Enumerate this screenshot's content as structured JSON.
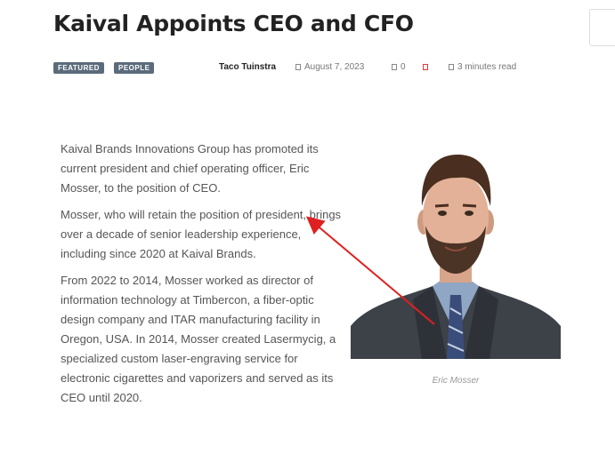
{
  "article": {
    "title": "Kaival Appoints CEO and CFO",
    "tags": [
      "FEATURED",
      "PEOPLE"
    ],
    "author": "Taco Tuinstra",
    "date": "August 7, 2023",
    "comments": "0",
    "read_time": "3 minutes read",
    "paragraphs": [
      "Kaival Brands Innovations Group has promoted its current president and chief operating officer, Eric Mosser, to the position of CEO.",
      "Mosser, who will retain the position of president, brings over a decade of senior leadership experience, including since 2020 at Kaival Brands.",
      "From 2022 to 2014, Mosser worked as director of information technology at Timbercon, a fiber-optic design company and ITAR manufacturing facility in Oregon, USA. In 2014, Mosser created Lasermycig, a specialized custom laser-engraving service for electronic cigarettes and vaporizers and served as its CEO until 2020."
    ],
    "photo_caption": "Eric Mosser"
  },
  "icons": {
    "date": "calendar-icon",
    "comments": "comment-icon",
    "share": "bookmark-icon",
    "read_time": "clock-icon"
  },
  "colors": {
    "tag_bg": "#5b6b7b",
    "accent_red": "#e03a3a",
    "arrow": "#e02020"
  }
}
